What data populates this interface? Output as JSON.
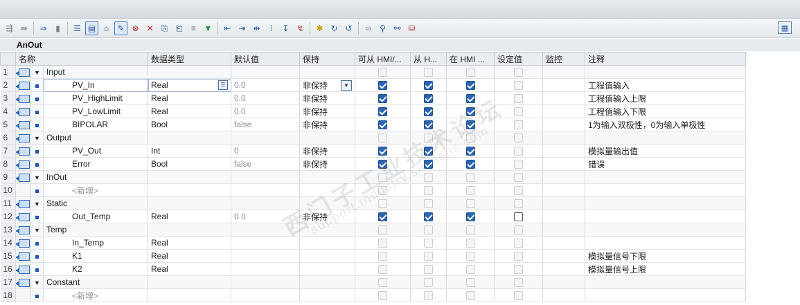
{
  "toolbar": {
    "icons": [
      "insert-row-icon",
      "add-row-icon",
      "expand-icon",
      "collapse-icon",
      "align-icon",
      "active-view-icon",
      "monitor-icon",
      "highlight-icon",
      "error-icon",
      "red-x-icon",
      "copy-icon",
      "paste-icon",
      "list-icon",
      "green-arrow-icon",
      "indent-icon",
      "outdent-icon",
      "align-left-icon",
      "grid-icon",
      "sort-icon",
      "red-sort-icon",
      "star-icon",
      "refresh-icon",
      "refresh2-icon",
      "goggles-icon",
      "binoculars-icon",
      "binoculars2-icon",
      "db-icon"
    ]
  },
  "block": {
    "title": "AnOut"
  },
  "columns": {
    "name": "名称",
    "type": "数据类型",
    "default": "默认值",
    "retain": "保持",
    "hmi_access": "可从 HMI/...",
    "hmi_from": "从 H...",
    "hmi_in": "在 HMI ...",
    "setpoint": "设定值",
    "monitor": "监控",
    "comment": "注释"
  },
  "rows": [
    {
      "no": "1",
      "name": "Input",
      "section": true,
      "type": "",
      "default": "",
      "retain": "",
      "c1": false,
      "c2": false,
      "c3": false,
      "c4": false,
      "comment": ""
    },
    {
      "no": "2",
      "name": "PV_In",
      "section": false,
      "type": "Real",
      "default": "0.0",
      "retain": "非保持",
      "c1": true,
      "c2": true,
      "c3": true,
      "c4": false,
      "comment": "工程值输入",
      "selected": true
    },
    {
      "no": "3",
      "name": "PV_HighLimit",
      "section": false,
      "type": "Real",
      "default": "0.0",
      "retain": "非保持",
      "c1": true,
      "c2": true,
      "c3": true,
      "c4": false,
      "comment": "工程值输入上限"
    },
    {
      "no": "4",
      "name": "PV_LowLimit",
      "section": false,
      "type": "Real",
      "default": "0.0",
      "retain": "非保持",
      "c1": true,
      "c2": true,
      "c3": true,
      "c4": false,
      "comment": "工程值输入下限"
    },
    {
      "no": "5",
      "name": "BIPOLAR",
      "section": false,
      "type": "Bool",
      "default": "false",
      "retain": "非保持",
      "c1": true,
      "c2": true,
      "c3": true,
      "c4": false,
      "comment": "1为输入双极性，0为输入单极性"
    },
    {
      "no": "6",
      "name": "Output",
      "section": true,
      "type": "",
      "default": "",
      "retain": "",
      "c1": false,
      "c2": false,
      "c3": false,
      "c4": false,
      "comment": ""
    },
    {
      "no": "7",
      "name": "PV_Out",
      "section": false,
      "type": "Int",
      "default": "0",
      "retain": "非保持",
      "c1": true,
      "c2": true,
      "c3": true,
      "c4": false,
      "comment": "模拟量输出值"
    },
    {
      "no": "8",
      "name": "Error",
      "section": false,
      "type": "Bool",
      "default": "false",
      "retain": "非保持",
      "c1": true,
      "c2": true,
      "c3": true,
      "c4": false,
      "comment": "错误"
    },
    {
      "no": "9",
      "name": "InOut",
      "section": true,
      "type": "",
      "default": "",
      "retain": "",
      "c1": false,
      "c2": false,
      "c3": false,
      "c4": false,
      "comment": ""
    },
    {
      "no": "10",
      "name": "<新增>",
      "section": false,
      "add": true,
      "type": "",
      "default": "",
      "retain": "",
      "c1": false,
      "c2": false,
      "c3": false,
      "c4": false,
      "comment": ""
    },
    {
      "no": "11",
      "name": "Static",
      "section": true,
      "type": "",
      "default": "",
      "retain": "",
      "c1": false,
      "c2": false,
      "c3": false,
      "c4": false,
      "comment": ""
    },
    {
      "no": "12",
      "name": "Out_Temp",
      "section": false,
      "type": "Real",
      "default": "0.0",
      "retain": "非保持",
      "c1": true,
      "c2": true,
      "c3": true,
      "c4": false,
      "c4dark": true,
      "comment": ""
    },
    {
      "no": "13",
      "name": "Temp",
      "section": true,
      "type": "",
      "default": "",
      "retain": "",
      "c1": false,
      "c2": false,
      "c3": false,
      "c4": false,
      "comment": ""
    },
    {
      "no": "14",
      "name": "In_Temp",
      "section": false,
      "type": "Real",
      "default": "",
      "retain": "",
      "c1": false,
      "c2": false,
      "c3": false,
      "c4": false,
      "comment": ""
    },
    {
      "no": "15",
      "name": "K1",
      "section": false,
      "type": "Real",
      "default": "",
      "retain": "",
      "c1": false,
      "c2": false,
      "c3": false,
      "c4": false,
      "comment": "模拟量信号下限"
    },
    {
      "no": "16",
      "name": "K2",
      "section": false,
      "type": "Real",
      "default": "",
      "retain": "",
      "c1": false,
      "c2": false,
      "c3": false,
      "c4": false,
      "comment": "模拟量信号上限"
    },
    {
      "no": "17",
      "name": "Constant",
      "section": true,
      "type": "",
      "default": "",
      "retain": "",
      "c1": false,
      "c2": false,
      "c3": false,
      "c4": false,
      "comment": ""
    },
    {
      "no": "18",
      "name": "<新增>",
      "section": false,
      "add": true,
      "type": "",
      "default": "",
      "retain": "",
      "c1": false,
      "c2": false,
      "c3": false,
      "c4": false,
      "comment": ""
    }
  ],
  "watermark": {
    "cn": "西门子工业技术论坛",
    "en": "support.industry.siemens.com"
  }
}
